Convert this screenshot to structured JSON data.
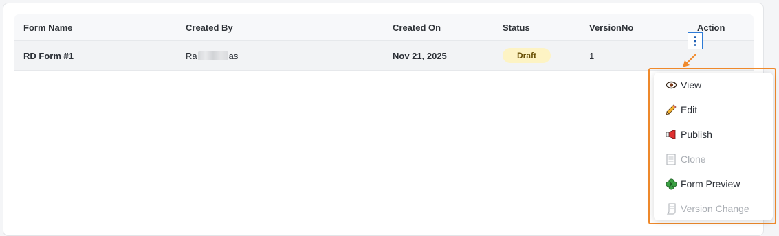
{
  "table": {
    "headers": {
      "form_name": "Form Name",
      "created_by": "Created By",
      "created_on": "Created On",
      "status": "Status",
      "version_no": "VersionNo",
      "action": "Action"
    },
    "rows": [
      {
        "form_name": "RD Form #1",
        "created_by_start": "Ra",
        "created_by_end": "as",
        "created_on": "Nov 21, 2025",
        "status": "Draft",
        "version_no": "1"
      }
    ]
  },
  "action_button": {
    "icon": "kebab-vertical-icon",
    "glyph": "⋮"
  },
  "menu": {
    "items": [
      {
        "label": "View",
        "icon": "eye-icon",
        "disabled": false
      },
      {
        "label": "Edit",
        "icon": "pencil-icon",
        "disabled": false
      },
      {
        "label": "Publish",
        "icon": "megaphone-icon",
        "disabled": false
      },
      {
        "label": "Clone",
        "icon": "document-icon",
        "disabled": true
      },
      {
        "label": "Form Preview",
        "icon": "clover-icon",
        "disabled": false
      },
      {
        "label": "Version Change",
        "icon": "scroll-icon",
        "disabled": true
      }
    ]
  },
  "colors": {
    "highlight": "#f08a2c",
    "draft_badge_bg": "#fdf3c4",
    "kebab_border": "#2e7bd6"
  }
}
